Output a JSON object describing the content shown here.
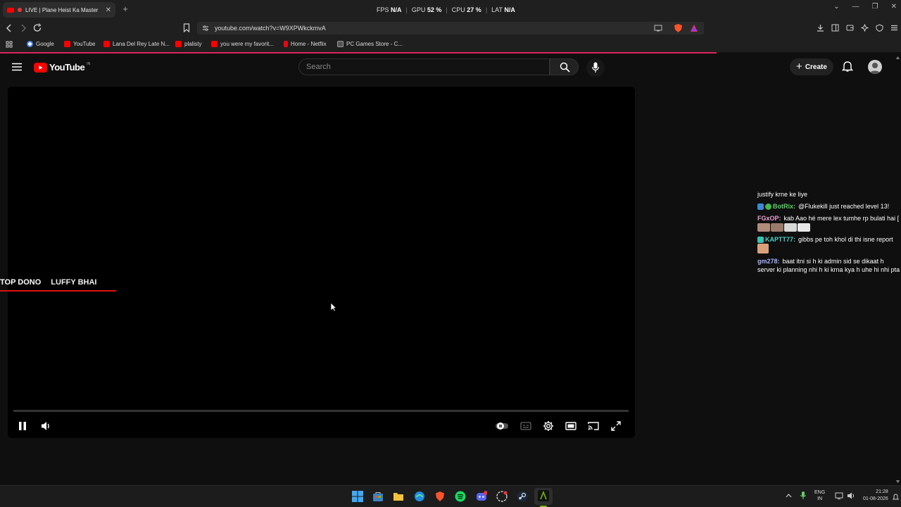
{
  "browser": {
    "tab_title": "LIVE | Plane Heist Ka Master",
    "url": "youtube.com/watch?v=W9XPWkckmvA",
    "perf": {
      "fps_label": "FPS",
      "fps_value": "N/A",
      "gpu_label": "GPU",
      "gpu_value": "52 %",
      "cpu_label": "CPU",
      "cpu_value": "27 %",
      "lat_label": "LAT",
      "lat_value": "N/A"
    },
    "bookmarks": [
      {
        "label": "Google",
        "color": "#4285f4"
      },
      {
        "label": "YouTube",
        "color": "#ff0000"
      },
      {
        "label": "Lana Del Rey Late N...",
        "color": "#ff0000"
      },
      {
        "label": "plalisty",
        "color": "#ff0000"
      },
      {
        "label": "you were my favorit...",
        "color": "#ff0000"
      },
      {
        "label": "Home - Netflix",
        "color": "#e50914"
      },
      {
        "label": "PC Games Store - C...",
        "color": "#555555"
      }
    ]
  },
  "youtube": {
    "logo_text": "YouTube",
    "country_code": "IN",
    "search_placeholder": "Search",
    "create_label": "Create"
  },
  "player": {
    "overlay_top": "TOP DONO",
    "overlay_name": "LUFFY BHAI"
  },
  "chat": {
    "messages": [
      {
        "author": "",
        "text": "justify krne ke liye",
        "author_color": "#ffffff"
      },
      {
        "author": "BotRix:",
        "text": "@Flukekill just reached level 13!",
        "author_color": "#56d364"
      },
      {
        "author": "FGxOP:",
        "text": "kab Aao hé mere lex tumhe rp bulati hai [",
        "author_color": "#e8a0d0"
      },
      {
        "author": "KAPTT77:",
        "text": "gibbs pe toh khol di thi isne report",
        "author_color": "#4fd1c5"
      },
      {
        "author": "gm278:",
        "text": "baat itni si h ki admin sid se dikaat h server ki planning nhi h ki krna kya h uhe hi nhi pta",
        "author_color": "#a6b4ff"
      }
    ]
  },
  "taskbar": {
    "lang": "ENG",
    "region": "IN",
    "time": "21:28",
    "date": "01-08-2026"
  }
}
